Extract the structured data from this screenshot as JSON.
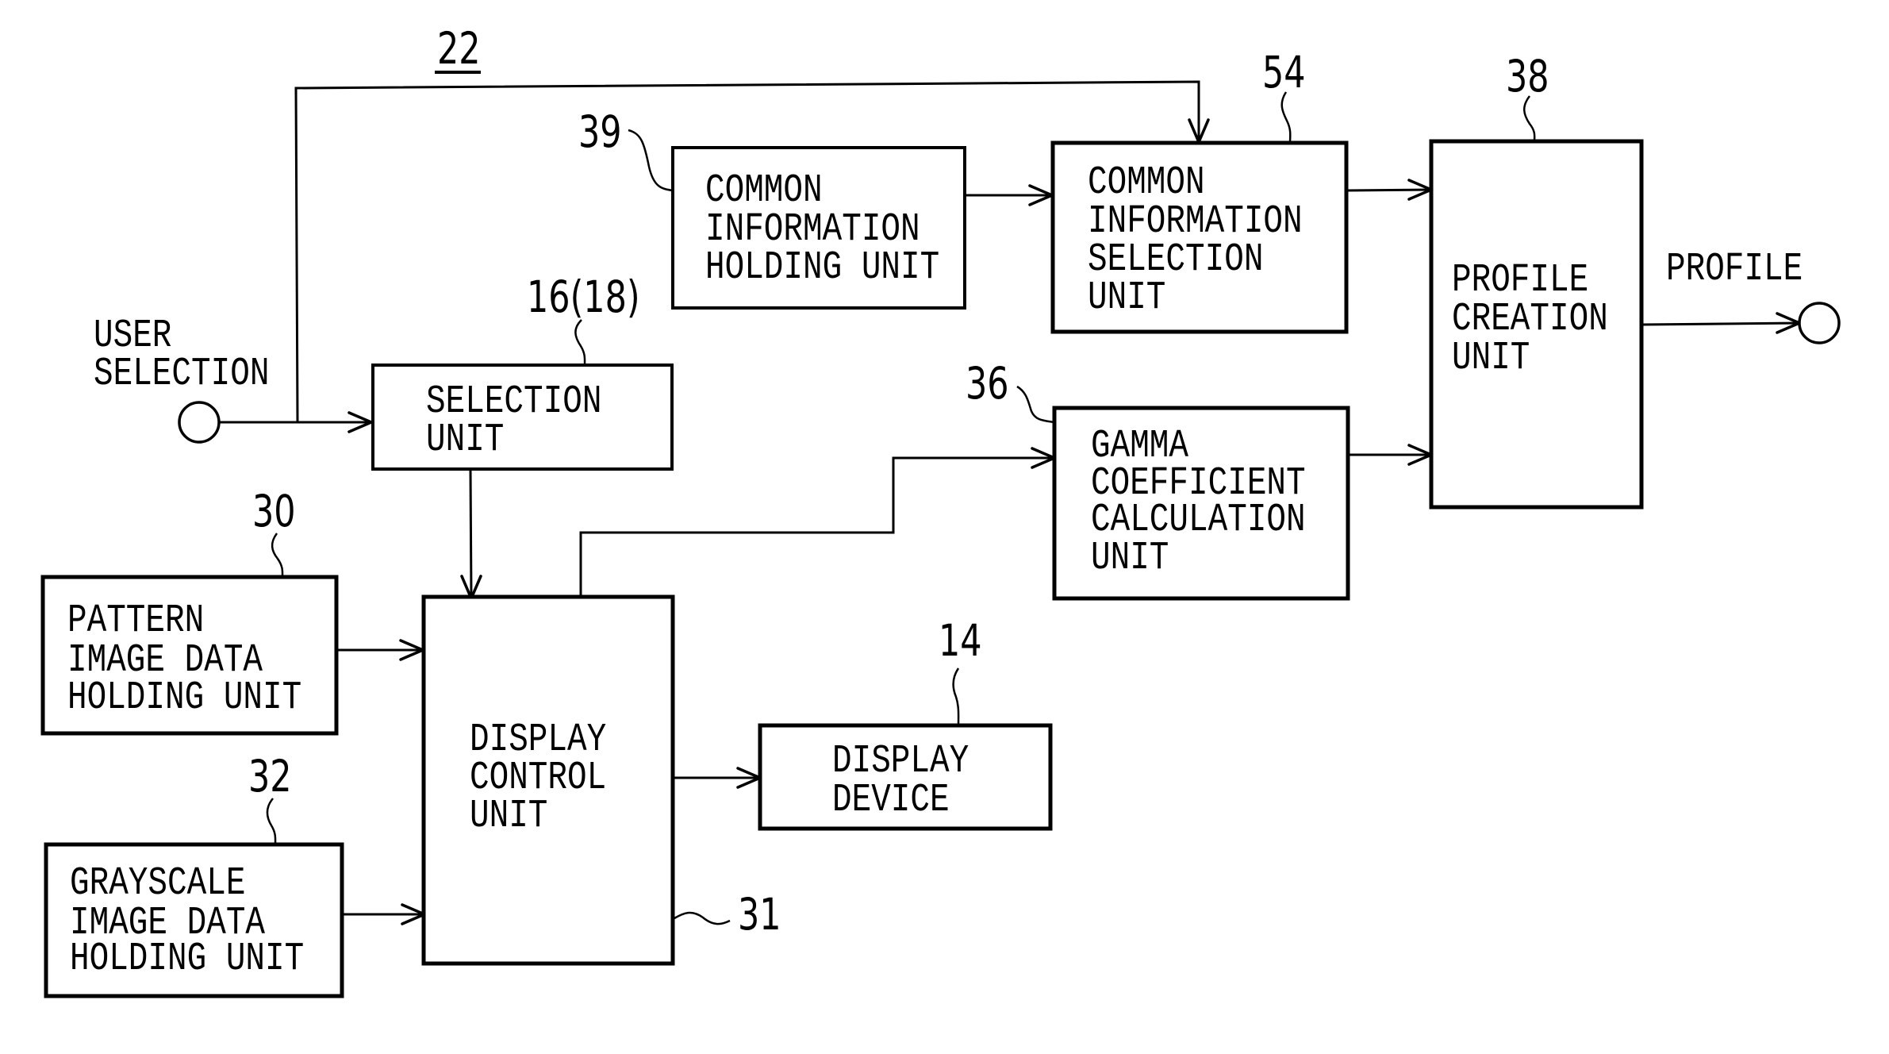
{
  "figure": {
    "reference_numeral": "22",
    "colors": {
      "ink": "#000000",
      "paper": "#ffffff"
    }
  },
  "input": {
    "label_lines": [
      "USER",
      "SELECTION"
    ],
    "terminal_icon": "open-circle-terminal"
  },
  "output": {
    "label": "PROFILE",
    "terminal_icon": "open-circle-terminal"
  },
  "blocks": {
    "common_info_holding": {
      "ref": "39",
      "lines": [
        "COMMON",
        "INFORMATION",
        "HOLDING UNIT"
      ]
    },
    "common_info_selection": {
      "ref": "54",
      "lines": [
        "COMMON",
        "INFORMATION",
        "SELECTION",
        "UNIT"
      ]
    },
    "profile_creation": {
      "ref": "38",
      "lines": [
        "PROFILE",
        "CREATION",
        "UNIT"
      ]
    },
    "selection_unit": {
      "ref": "16(18)",
      "lines": [
        "SELECTION",
        "UNIT"
      ]
    },
    "gamma_calc": {
      "ref": "36",
      "lines": [
        "GAMMA",
        "COEFFICIENT",
        "CALCULATION",
        "UNIT"
      ]
    },
    "pattern_image": {
      "ref": "30",
      "lines": [
        "PATTERN",
        "IMAGE DATA",
        "HOLDING UNIT"
      ]
    },
    "grayscale_image": {
      "ref": "32",
      "lines": [
        "GRAYSCALE",
        "IMAGE DATA",
        "HOLDING UNIT"
      ]
    },
    "display_control": {
      "ref": "31",
      "lines": [
        "DISPLAY",
        "CONTROL",
        "UNIT"
      ]
    },
    "display_device": {
      "ref": "14",
      "lines": [
        "DISPLAY",
        "DEVICE"
      ]
    }
  },
  "connections": [
    {
      "from": "user_selection",
      "to": "selection_unit"
    },
    {
      "from": "user_selection",
      "to": "common_info_selection"
    },
    {
      "from": "common_info_holding",
      "to": "common_info_selection"
    },
    {
      "from": "common_info_selection",
      "to": "profile_creation"
    },
    {
      "from": "gamma_calc",
      "to": "profile_creation"
    },
    {
      "from": "selection_unit",
      "to": "display_control"
    },
    {
      "from": "pattern_image",
      "to": "display_control"
    },
    {
      "from": "grayscale_image",
      "to": "display_control"
    },
    {
      "from": "display_control",
      "to": "gamma_calc"
    },
    {
      "from": "display_control",
      "to": "display_device"
    },
    {
      "from": "profile_creation",
      "to": "profile_output"
    }
  ]
}
